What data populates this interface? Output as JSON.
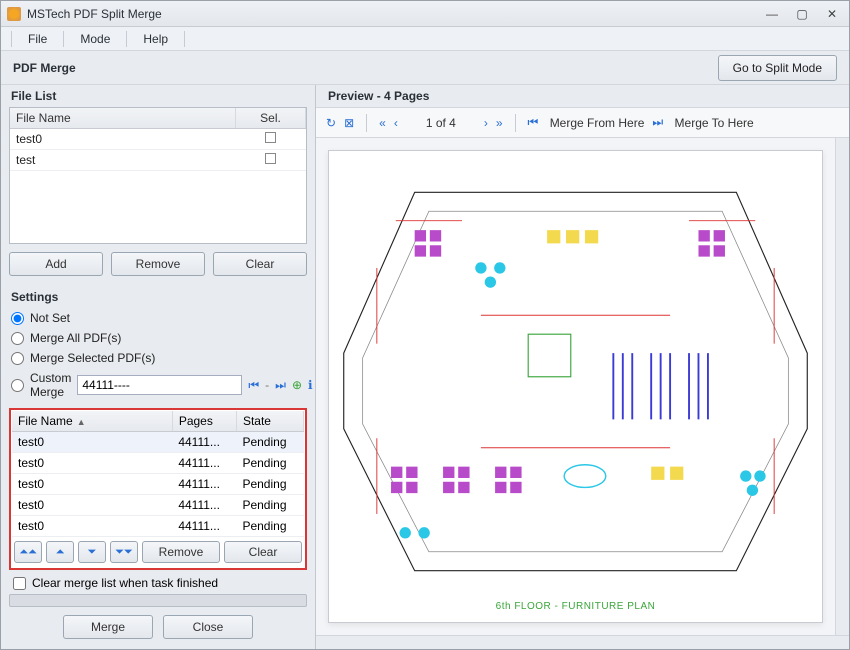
{
  "window": {
    "title": "MSTech PDF Split Merge"
  },
  "menu": {
    "file": "File",
    "mode": "Mode",
    "help": "Help"
  },
  "subheader": {
    "title": "PDF Merge",
    "mode_btn": "Go to Split Mode"
  },
  "filelist": {
    "title": "File List",
    "cols": {
      "name": "File Name",
      "sel": "Sel."
    },
    "rows": [
      {
        "name": "test0",
        "sel": false
      },
      {
        "name": "test",
        "sel": false
      }
    ],
    "buttons": {
      "add": "Add",
      "remove": "Remove",
      "clear": "Clear"
    }
  },
  "settings": {
    "title": "Settings",
    "opt_not_set": "Not Set",
    "opt_merge_all": "Merge All PDF(s)",
    "opt_merge_sel": "Merge Selected PDF(s)",
    "opt_custom": "Custom Merge",
    "custom_value": "44111----"
  },
  "mergelist": {
    "cols": {
      "name": "File Name",
      "pages": "Pages",
      "state": "State"
    },
    "rows": [
      {
        "name": "test0",
        "pages": "44111...",
        "state": "Pending"
      },
      {
        "name": "test0",
        "pages": "44111...",
        "state": "Pending"
      },
      {
        "name": "test0",
        "pages": "44111...",
        "state": "Pending"
      },
      {
        "name": "test0",
        "pages": "44111...",
        "state": "Pending"
      },
      {
        "name": "test0",
        "pages": "44111...",
        "state": "Pending"
      }
    ],
    "buttons": {
      "remove": "Remove",
      "clear": "Clear"
    }
  },
  "clear_after": "Clear merge list when task finished",
  "footer": {
    "merge": "Merge",
    "close": "Close"
  },
  "preview": {
    "title": "Preview - 4 Pages",
    "counter": "1 of 4",
    "merge_from": "Merge From Here",
    "merge_to": "Merge To Here",
    "caption": "6th FLOOR - FURNITURE PLAN"
  }
}
